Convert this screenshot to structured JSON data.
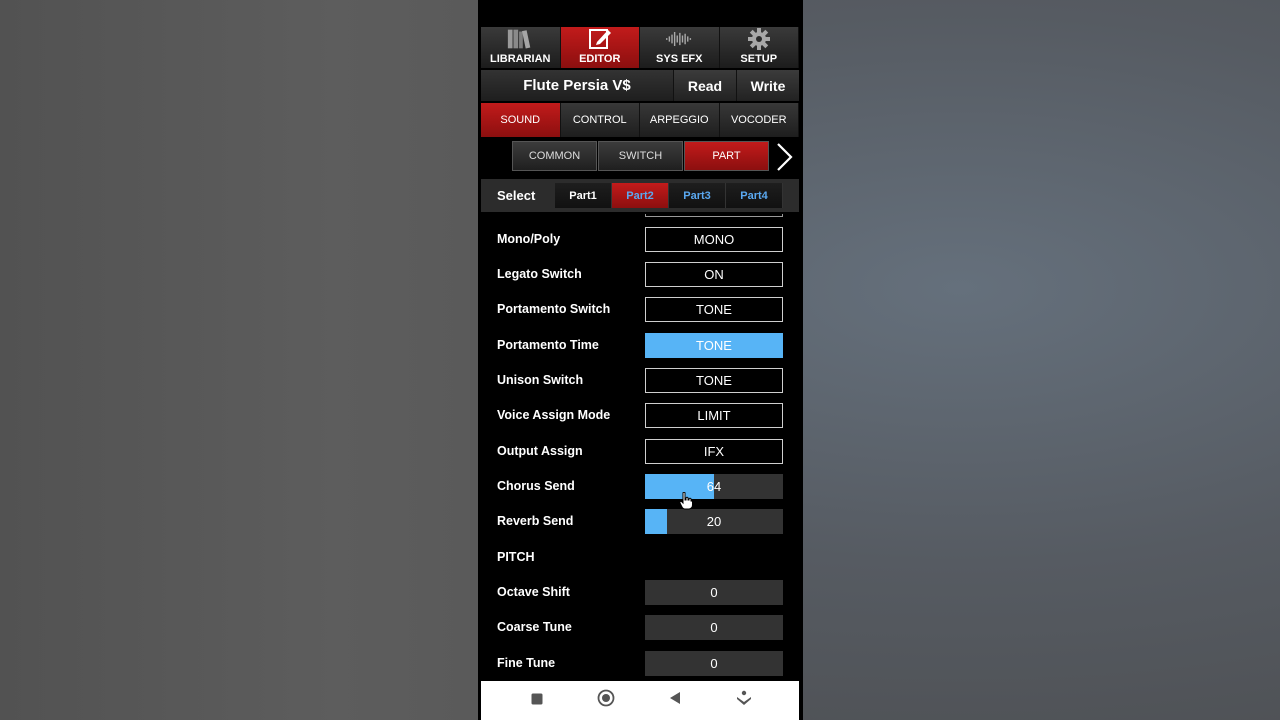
{
  "top_tabs": [
    {
      "label": "LIBRARIAN",
      "icon": "books-icon"
    },
    {
      "label": "EDITOR",
      "icon": "edit-icon",
      "active": true
    },
    {
      "label": "SYS EFX",
      "icon": "waveform-icon"
    },
    {
      "label": "SETUP",
      "icon": "gear-icon"
    }
  ],
  "title_bar": {
    "patch_name": "Flute Persia V$",
    "read_label": "Read",
    "write_label": "Write"
  },
  "section_tabs": [
    "SOUND",
    "CONTROL",
    "ARPEGGIO",
    "VOCODER"
  ],
  "sub_tabs": [
    "COMMON",
    "SWITCH",
    "PART"
  ],
  "select": {
    "label": "Select",
    "parts": [
      "Part1",
      "Part2",
      "Part3",
      "Part4"
    ]
  },
  "params": {
    "mono_poly": {
      "label": "Mono/Poly",
      "value": "MONO"
    },
    "legato_switch": {
      "label": "Legato Switch",
      "value": "ON"
    },
    "portamento_switch": {
      "label": "Portamento Switch",
      "value": "TONE"
    },
    "portamento_time": {
      "label": "Portamento Time",
      "value": "TONE"
    },
    "unison_switch": {
      "label": "Unison Switch",
      "value": "TONE"
    },
    "voice_assign_mode": {
      "label": "Voice Assign Mode",
      "value": "LIMIT"
    },
    "output_assign": {
      "label": "Output Assign",
      "value": "IFX"
    },
    "chorus_send": {
      "label": "Chorus Send",
      "value": "64",
      "fill": 0.5
    },
    "reverb_send": {
      "label": "Reverb Send",
      "value": "20",
      "fill": 0.16
    },
    "pitch_heading": "PITCH",
    "octave_shift": {
      "label": "Octave Shift",
      "value": "0"
    },
    "coarse_tune": {
      "label": "Coarse Tune",
      "value": "0"
    },
    "fine_tune": {
      "label": "Fine Tune",
      "value": "0"
    }
  },
  "colors": {
    "accent_red": "#b01515",
    "slider_blue": "#57b4f6",
    "part_blue": "#5aa8f0",
    "part_active_text": "#5aa8f0"
  }
}
